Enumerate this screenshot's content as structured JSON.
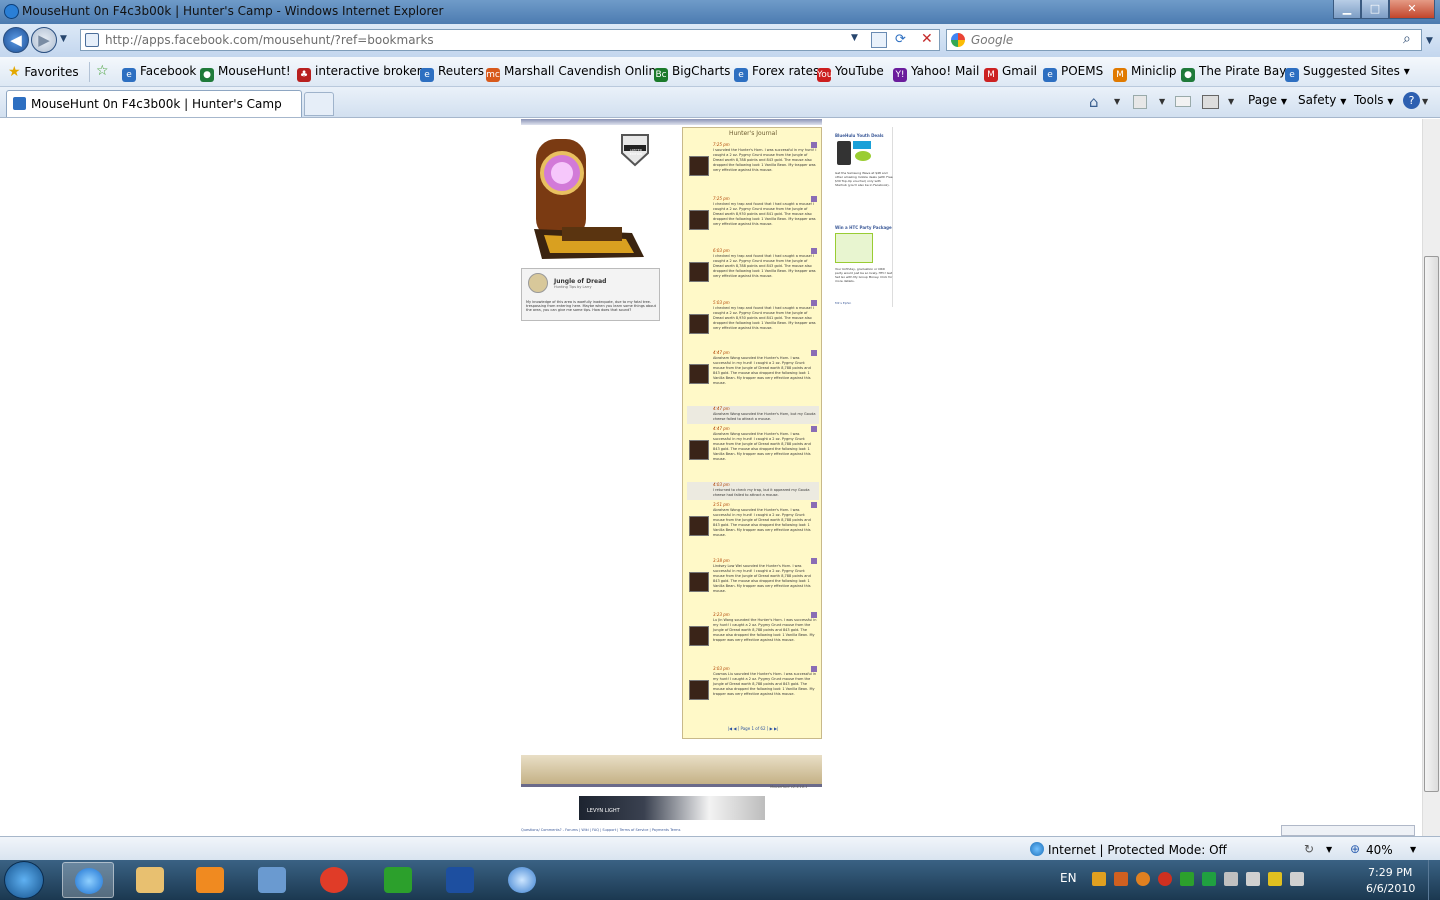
{
  "window": {
    "title": "MouseHunt 0n F4c3b00k | Hunter's Camp - Windows Internet Explorer",
    "minimize": "▁",
    "maximize": "□",
    "close": "✕"
  },
  "nav": {
    "address": "http://apps.facebook.com/mousehunt/?ref=bookmarks",
    "address_host": "facebook.com",
    "search_placeholder": "Google"
  },
  "favorites": {
    "label": "Favorites",
    "items": [
      {
        "label": "Facebook",
        "color": "#2d6fc1",
        "glyph": "e"
      },
      {
        "label": "MouseHunt!",
        "color": "#1f7a3a",
        "glyph": "●"
      },
      {
        "label": "interactive brokers",
        "color": "#b8201f",
        "glyph": "♣"
      },
      {
        "label": "Reuters",
        "color": "#2d6fc1",
        "glyph": "e"
      },
      {
        "label": "Marshall Cavendish Online",
        "color": "#d85a1c",
        "glyph": "mc"
      },
      {
        "label": "BigCharts",
        "color": "#1a7a2a",
        "glyph": "Bc"
      },
      {
        "label": "Forex rates",
        "color": "#2d6fc1",
        "glyph": "e"
      },
      {
        "label": "YouTube",
        "color": "#cc1e1e",
        "glyph": "You"
      },
      {
        "label": "Yahoo! Mail",
        "color": "#6a1c9c",
        "glyph": "Y!"
      },
      {
        "label": "Gmail",
        "color": "#cc2222",
        "glyph": "M"
      },
      {
        "label": "POEMS",
        "color": "#2d6fc1",
        "glyph": "e"
      },
      {
        "label": "Miniclip",
        "color": "#e07a00",
        "glyph": "M"
      },
      {
        "label": "The Pirate Bay",
        "color": "#1f7a3a",
        "glyph": "●"
      },
      {
        "label": "Suggested Sites",
        "color": "#2d6fc1",
        "glyph": "e"
      }
    ]
  },
  "tab": {
    "title": "MouseHunt 0n F4c3b00k | Hunter's Camp"
  },
  "commands": {
    "page": "Page",
    "safety": "Safety",
    "tools": "Tools",
    "help": "?"
  },
  "page": {
    "location_name": "Jungle of Dread",
    "location_sub": "Hunting Tips by Larry",
    "location_tip": "My knowledge of this area is woefully inadequate, due to my fatal tree-trespassing from entering here. Maybe when you learn some things about the area, you can give me some tips. How does that sound?",
    "limited_badge": "LIMITED EDITION",
    "journal_title": "Hunter's Journal",
    "journal_pager": "|◀ ◀ [ Page 1 of 62 ] ▶ ▶|",
    "footer_version": "MouseHunt v2.4.18.1",
    "footer_links": "Questions/ Comments? - Forums | Wiki | FAQ | Support | Terms of Service | Payments Terms",
    "ad1_title": "BlueHulu Youth Deals",
    "ad1_text": "Get the Samsung Wave at $48 and other amazing mobile deals (with Free $30 Top-Up voucher) only with Starhub (you'll also be in Facebook).",
    "ad2_title": "Win a HTC Party Package",
    "ad2_text": "Your birthday, graduation or ORD party would just be so lively. HTC! Get Set Go with My Group Money. Click for more details.",
    "ad_more": "M1's Ephin",
    "banner_text": "LEVYN LIGHT",
    "journal_entries": [
      {
        "time": "7:25 pm",
        "text": "I sounded the Hunter's Horn. I was successful in my hunt! I caught a 2 oz. Pygmy Grunt mouse from the Jungle of Dread worth 8,788 points and 843 gold. The mouse also dropped the following loot: 1 Vanilla Bean. My trapper was very effective against this mouse."
      },
      {
        "time": "7:25 pm",
        "text": "I checked my trap and found that I had caught a mouse! I caught a 2 oz. Pygmy Grunt mouse from the Jungle of Dread worth 8,930 points and 841 gold. The mouse also dropped the following loot: 1 Vanilla Bean. My trapper was very effective against this mouse."
      },
      {
        "time": "6:03 pm",
        "text": "I checked my trap and found that I had caught a mouse! I caught a 2 oz. Pygmy Grunt mouse from the Jungle of Dread worth 8,788 points and 843 gold. The mouse also dropped the following loot: 1 Vanilla Bean. My trapper was very effective against this mouse."
      },
      {
        "time": "5:03 pm",
        "text": "I checked my trap and found that I had caught a mouse! I caught a 2 oz. Pygmy Grunt mouse from the Jungle of Dread worth 8,930 points and 841 gold. The mouse also dropped the following loot: 1 Vanilla Bean. My trapper was very effective against this mouse."
      },
      {
        "time": "4:47 pm",
        "text": "Abraham Wong sounded the Hunter's Horn. I was successful in my hunt! I caught a 2 oz. Pygmy Grunt mouse from the Jungle of Dread worth 8,788 points and 843 gold. The mouse also dropped the following loot: 1 Vanilla Bean. My trapper was very effective against this mouse."
      },
      {
        "time": "4:47 pm",
        "text": "Abraham Wong sounded the Hunter's Horn, but my Gouda cheese failed to attract a mouse."
      },
      {
        "time": "4:47 pm",
        "text": "Abraham Wong sounded the Hunter's Horn. I was successful in my hunt! I caught a 2 oz. Pygmy Grunt mouse from the Jungle of Dread worth 8,788 points and 843 gold. The mouse also dropped the following loot: 1 Vanilla Bean. My trapper was very effective against this mouse."
      },
      {
        "time": "4:03 pm",
        "text": "I returned to check my trap, but it appeared my Gouda cheese had failed to attract a mouse."
      },
      {
        "time": "3:51 pm",
        "text": "Abraham Wong sounded the Hunter's Horn. I was successful in my hunt! I caught a 2 oz. Pygmy Grunt mouse from the Jungle of Dread worth 8,788 points and 843 gold. The mouse also dropped the following loot: 1 Vanilla Bean. My trapper was very effective against this mouse."
      },
      {
        "time": "3:38 pm",
        "text": "Lindsey Low Wei sounded the Hunter's Horn. I was successful in my hunt! I caught a 2 oz. Pygmy Grunt mouse from the Jungle of Dread worth 8,788 points and 843 gold. The mouse also dropped the following loot: 1 Vanilla Bean. My trapper was very effective against this mouse."
      },
      {
        "time": "3:23 pm",
        "text": "Lu Jin Wong sounded the Hunter's Horn. I was successful in my hunt! I caught a 2 oz. Pygmy Grunt mouse from the Jungle of Dread worth 8,788 points and 843 gold. The mouse also dropped the following loot: 1 Vanilla Bean. My trapper was very effective against this mouse."
      },
      {
        "time": "3:03 pm",
        "text": "Cosmos Liu sounded the Hunter's Horn. I was successful in my hunt! I caught a 2 oz. Pygmy Grunt mouse from the Jungle of Dread worth 8,788 points and 843 gold. The mouse also dropped the following loot: 1 Vanilla Bean. My trapper was very effective against this mouse."
      }
    ]
  },
  "status": {
    "zone": "Internet | Protected Mode: Off",
    "zoom": "40%"
  },
  "taskbar": {
    "lang": "EN",
    "time": "7:29 PM",
    "date": "6/6/2010"
  }
}
